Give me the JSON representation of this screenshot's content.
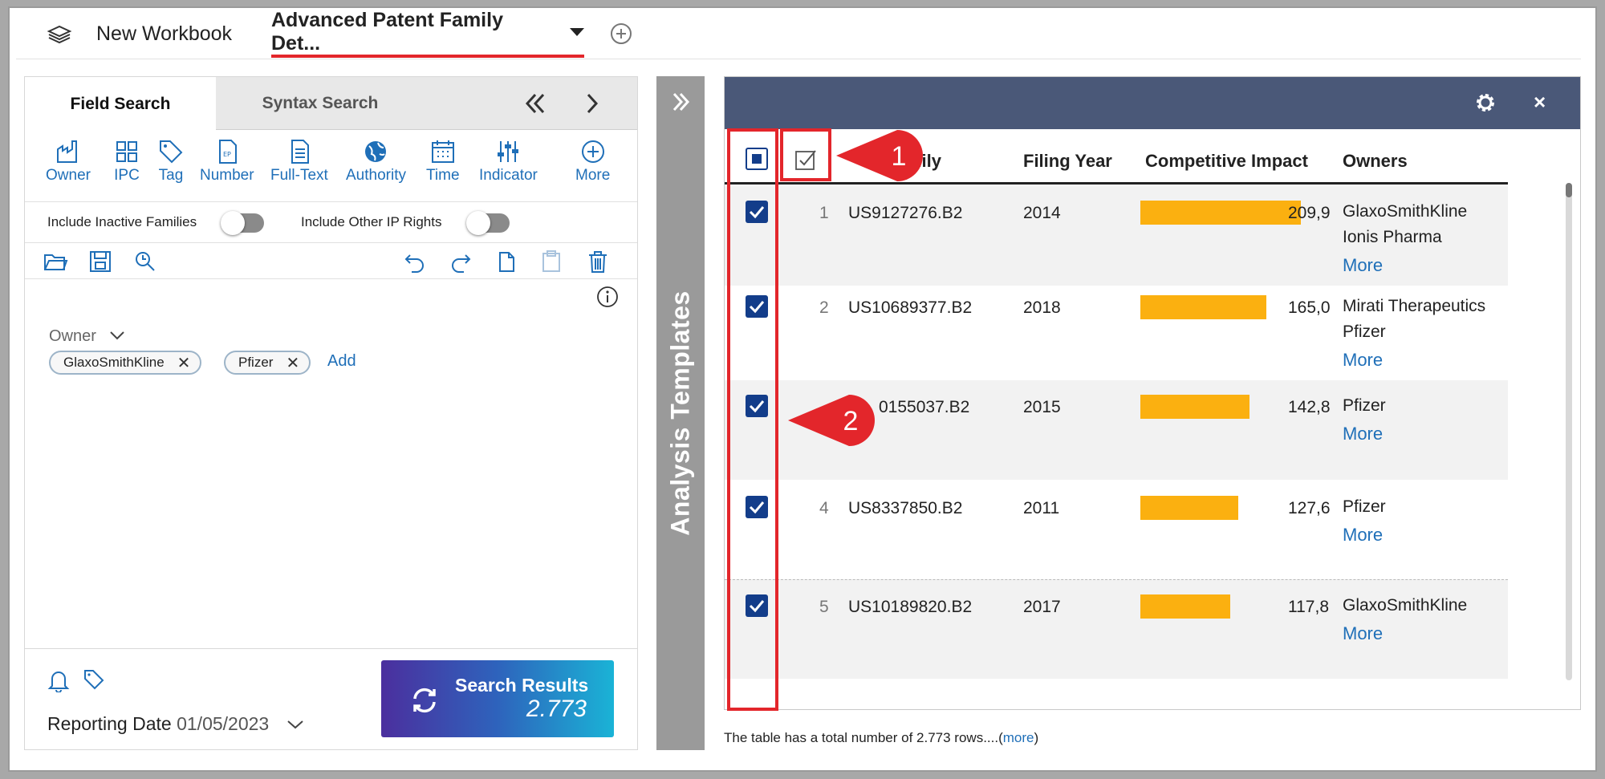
{
  "workbook_tabs": {
    "new_workbook": "New Workbook",
    "active": "Advanced Patent Family Det...",
    "add_icon": "plus-circle-icon"
  },
  "left_panel": {
    "tabs": [
      "Field Search",
      "Syntax Search"
    ],
    "tools": [
      "Owner",
      "IPC",
      "Tag",
      "Number",
      "Full-Text",
      "Authority",
      "Time",
      "Indicator",
      "More"
    ],
    "include_inactive": "Include Inactive Families",
    "include_other_ip": "Include Other IP Rights",
    "owner_label": "Owner",
    "chips": [
      "GlaxoSmithKline",
      "Pfizer"
    ],
    "add": "Add",
    "reporting_label": "Reporting Date",
    "reporting_date": "01/05/2023",
    "search_label": "Search Results",
    "search_count": "2.773"
  },
  "analysis_templates": "Analysis Templates",
  "table": {
    "columns": [
      "Family",
      "Filing Year",
      "Competitive Impact",
      "Owners"
    ],
    "family_header_visible": "mily",
    "rows": [
      {
        "idx": "1",
        "family": "US9127276.B2",
        "year": "2014",
        "impact": "209,9",
        "impact_value": 209.9,
        "owners": [
          "GlaxoSmithKline",
          "Ionis Pharma"
        ],
        "more": "More"
      },
      {
        "idx": "2",
        "family": "US10689377.B2",
        "year": "2018",
        "impact": "165,0",
        "impact_value": 165.0,
        "owners": [
          "Mirati Therapeutics",
          "Pfizer"
        ],
        "more": "More"
      },
      {
        "idx": "",
        "family": "0155037.B2",
        "year": "2015",
        "impact": "142,8",
        "impact_value": 142.8,
        "owners": [
          "Pfizer"
        ],
        "more": "More"
      },
      {
        "idx": "4",
        "family": "US8337850.B2",
        "year": "2011",
        "impact": "127,6",
        "impact_value": 127.6,
        "owners": [
          "Pfizer"
        ],
        "more": "More"
      },
      {
        "idx": "5",
        "family": "US10189820.B2",
        "year": "2017",
        "impact": "117,8",
        "impact_value": 117.8,
        "owners": [
          "GlaxoSmithKline"
        ],
        "more": "More"
      }
    ],
    "footer": "The table has a total number of 2.773 rows....(",
    "footer_link": "more",
    "footer_close": ")"
  },
  "callouts": [
    "1",
    "2"
  ],
  "colors": {
    "accent_red": "#e3262b",
    "checkbox_blue": "#133d8a",
    "bar_orange": "#fbb010",
    "header_slate": "#4a5878",
    "link_blue": "#1f6fb8"
  }
}
